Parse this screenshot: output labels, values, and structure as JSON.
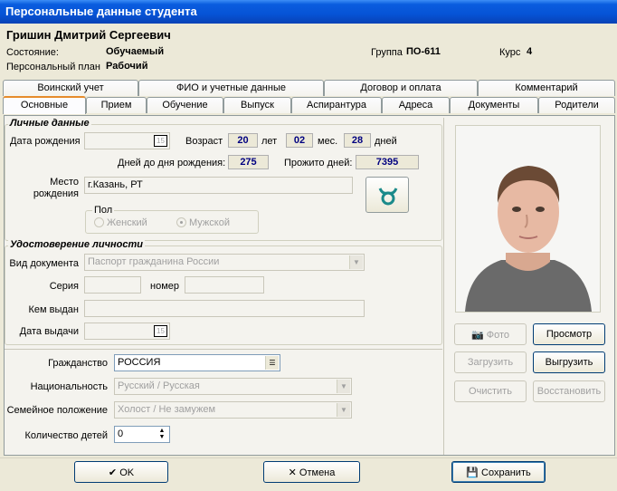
{
  "window": {
    "title": "Персональные данные студента"
  },
  "header": {
    "student_name": "Гришин Дмитрий Сергеевич",
    "state_label": "Состояние:",
    "state_value": "Обучаемый",
    "plan_label": "Персональный план",
    "plan_value": "Рабочий",
    "group_label": "Группа",
    "group_value": "ПО-611",
    "course_label": "Курс",
    "course_value": "4"
  },
  "tabs": {
    "row1": [
      "Воинский учет",
      "ФИО и учетные данные",
      "Договор и оплата",
      "Комментарий"
    ],
    "row2": [
      "Основные",
      "Прием",
      "Обучение",
      "Выпуск",
      "Аспирантура",
      "Адреса",
      "Документы",
      "Родители"
    ],
    "active": "Основные"
  },
  "personal": {
    "group_title": "Личные данные",
    "dob_label": "Дата рождения",
    "dob_value": "",
    "age_label": "Возраст",
    "age_years": "20",
    "years_unit": "лет",
    "age_months": "02",
    "months_unit": "мес.",
    "age_days": "28",
    "days_unit": "дней",
    "days_to_birthday_label": "Дней до дня рождения:",
    "days_to_birthday": "275",
    "days_lived_label": "Прожито дней:",
    "days_lived": "7395",
    "birthplace_label_1": "Место",
    "birthplace_label_2": "рождения",
    "birthplace_value": "г.Казань, РТ",
    "gender_title": "Пол",
    "gender_female": "Женский",
    "gender_male": "Мужской",
    "gender_selected": "Мужской",
    "zodiac_icon": "taurus-icon"
  },
  "identity": {
    "group_title": "Удостоверение личности",
    "doc_type_label": "Вид документа",
    "doc_type_value": "Паспорт гражданина России",
    "series_label": "Серия",
    "series_value": "",
    "number_label": "номер",
    "number_value": "",
    "issued_by_label": "Кем выдан",
    "issued_by_value": "",
    "issue_date_label": "Дата выдачи",
    "issue_date_value": ""
  },
  "other": {
    "citizenship_label": "Гражданство",
    "citizenship_value": "РОССИЯ",
    "nationality_label": "Национальность",
    "nationality_value": "Русский / Русская",
    "marital_label": "Семейное положение",
    "marital_value": "Холост / Не замужем",
    "children_label": "Количество детей",
    "children_value": "0"
  },
  "photo_buttons": {
    "photo": "Фото",
    "view": "Просмотр",
    "load": "Загрузить",
    "unload": "Выгрузить",
    "clear": "Очистить",
    "restore": "Восстановить"
  },
  "footer": {
    "ok": "OK",
    "cancel": "Отмена",
    "save": "Сохранить"
  },
  "colors": {
    "titlebar": "#0a5ddf",
    "tab_active_accent": "#e68b2c",
    "value_text": "#000080"
  }
}
